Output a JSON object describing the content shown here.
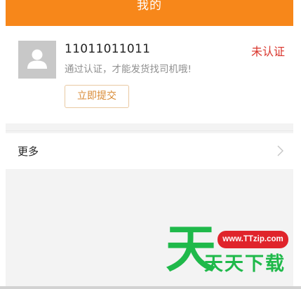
{
  "header": {
    "title": "我的",
    "background": "#f7871a"
  },
  "profile": {
    "avatar_icon": "user-silhouette-icon",
    "phone": "11011011011",
    "hint": "通过认证，才能发货找司机哦!",
    "status": "未认证",
    "status_color": "#d9342b",
    "submit_label": "立即提交"
  },
  "menu": {
    "more_label": "更多",
    "more_icon": "chevron-right-icon"
  },
  "watermark": {
    "big_char": "天",
    "url": "www.TTzip.com",
    "text": "天天下载"
  }
}
